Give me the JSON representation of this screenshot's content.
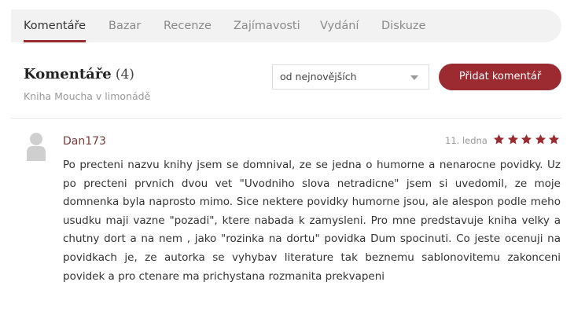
{
  "tabs": [
    {
      "label": "Komentáře",
      "active": true
    },
    {
      "label": "Bazar",
      "active": false
    },
    {
      "label": "Recenze",
      "active": false
    },
    {
      "label": "Zajímavosti",
      "active": false
    },
    {
      "label": "Vydání",
      "active": false
    },
    {
      "label": "Diskuze",
      "active": false
    }
  ],
  "section": {
    "title": "Komentáře",
    "count": "(4)",
    "subtitle": "Kniha Moucha v limonádě"
  },
  "sort": {
    "selected": "od nejnovějších"
  },
  "add_comment_label": "Přidat komentář",
  "comment": {
    "author": "Dan173",
    "date": "11. ledna",
    "rating": 5,
    "rating_max": 5,
    "text": "Po precteni nazvu knihy jsem se domnival, ze se jedna o humorne a nenarocne povidky. Uz po precteni prvnich dvou vet \"Uvodniho slova netradicne\" jsem si uvedomil, ze moje domnenka byla naprosto mimo. Sice nektere povidky humorne jsou, ale alespon podle meho usudku maji vazne \"pozadi\", ktere nabada k zamysleni. Pro mne predstavuje kniha velky a chutny dort a na nem , jako \"rozinka na dortu\" povidka Dum spocinuti. Co jeste ocenuji na povidkach je, ze autorka se vyhybav literature tak beznemu sablonovitemu zakonceni povidek a pro ctenare ma prichystana rozmanita prekvapeni"
  },
  "colors": {
    "accent": "#9b2b30",
    "star": "#9b2b30",
    "author": "#7a3b3b",
    "tabbar_bg": "#f2f2f2"
  },
  "icons": {
    "avatar": "user-silhouette-icon",
    "star": "star-icon",
    "dropdown": "chevron-down-icon"
  }
}
